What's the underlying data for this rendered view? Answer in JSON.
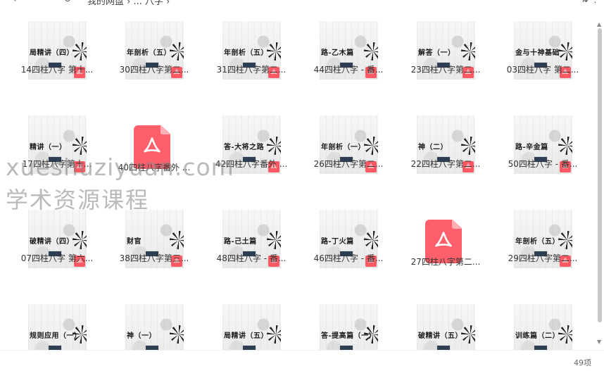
{
  "toolbar": {
    "back_icon": "chevron-left-icon",
    "refresh_icon": "refresh-icon",
    "breadcrumb": "我的网盘 › ... 八字 ›",
    "sort_icon": "sort-icon",
    "more_icon": "more-icon"
  },
  "files": [
    {
      "label": "14四柱八字 第十...",
      "thumb_title": "局精讲（四）",
      "type": "thumb"
    },
    {
      "label": "30四柱八字第二...",
      "thumb_title": "年剖析（五）",
      "type": "thumb"
    },
    {
      "label": "31四柱八字第二...",
      "thumb_title": "年剖析（五）",
      "type": "thumb"
    },
    {
      "label": "44四柱八字 - 番...",
      "thumb_title": "路-乙木篇",
      "type": "thumb"
    },
    {
      "label": "23四柱八字第二...",
      "thumb_title": "解答（一）",
      "type": "thumb"
    },
    {
      "label": "03四柱八字 第二...",
      "thumb_title": "金与十神基础",
      "type": "thumb"
    },
    {
      "label": "17四柱八字第十...",
      "thumb_title": "精讲（一）",
      "type": "thumb"
    },
    {
      "label": "40四柱八字番外 ...",
      "thumb_title": "",
      "type": "pdf"
    },
    {
      "label": "42四柱八字番外 ...",
      "thumb_title": "答-大将之路",
      "type": "thumb"
    },
    {
      "label": "26四柱八字第二...",
      "thumb_title": "年剖析（一）",
      "type": "thumb"
    },
    {
      "label": "22四柱八字第二...",
      "thumb_title": "神（二）",
      "type": "thumb"
    },
    {
      "label": "50四柱八字 - 番...",
      "thumb_title": "路-辛金篇",
      "type": "thumb"
    },
    {
      "label": "07四柱八字 第六...",
      "thumb_title": "破精讲（四）",
      "type": "thumb"
    },
    {
      "label": "38四柱八字第三...",
      "thumb_title": "财官",
      "type": "thumb"
    },
    {
      "label": "48四柱八字 - 番...",
      "thumb_title": "路-己土篇",
      "type": "thumb"
    },
    {
      "label": "46四柱八字 - 番...",
      "thumb_title": "路-丁火篇",
      "type": "thumb"
    },
    {
      "label": "27四柱八字第二...",
      "thumb_title": "",
      "type": "pdf"
    },
    {
      "label": "29四柱八字第二...",
      "thumb_title": "年剖析（五）",
      "type": "thumb"
    },
    {
      "label": "",
      "thumb_title": "规则应用（一）",
      "type": "thumb"
    },
    {
      "label": "",
      "thumb_title": "神（一）",
      "type": "thumb"
    },
    {
      "label": "",
      "thumb_title": "局精讲（五）",
      "type": "thumb"
    },
    {
      "label": "",
      "thumb_title": "答-提高篇（一）",
      "type": "thumb"
    },
    {
      "label": "",
      "thumb_title": "破精讲（五）",
      "type": "thumb"
    },
    {
      "label": "",
      "thumb_title": "训练篇（二）",
      "type": "thumb"
    }
  ],
  "watermark": {
    "line1": "xueshuziyuan.com",
    "line2": "学术资源课程"
  },
  "status": {
    "item_count": "49项"
  },
  "colors": {
    "pdf_red": "#ff5f6b",
    "stamp_navy": "#2e3f54"
  }
}
